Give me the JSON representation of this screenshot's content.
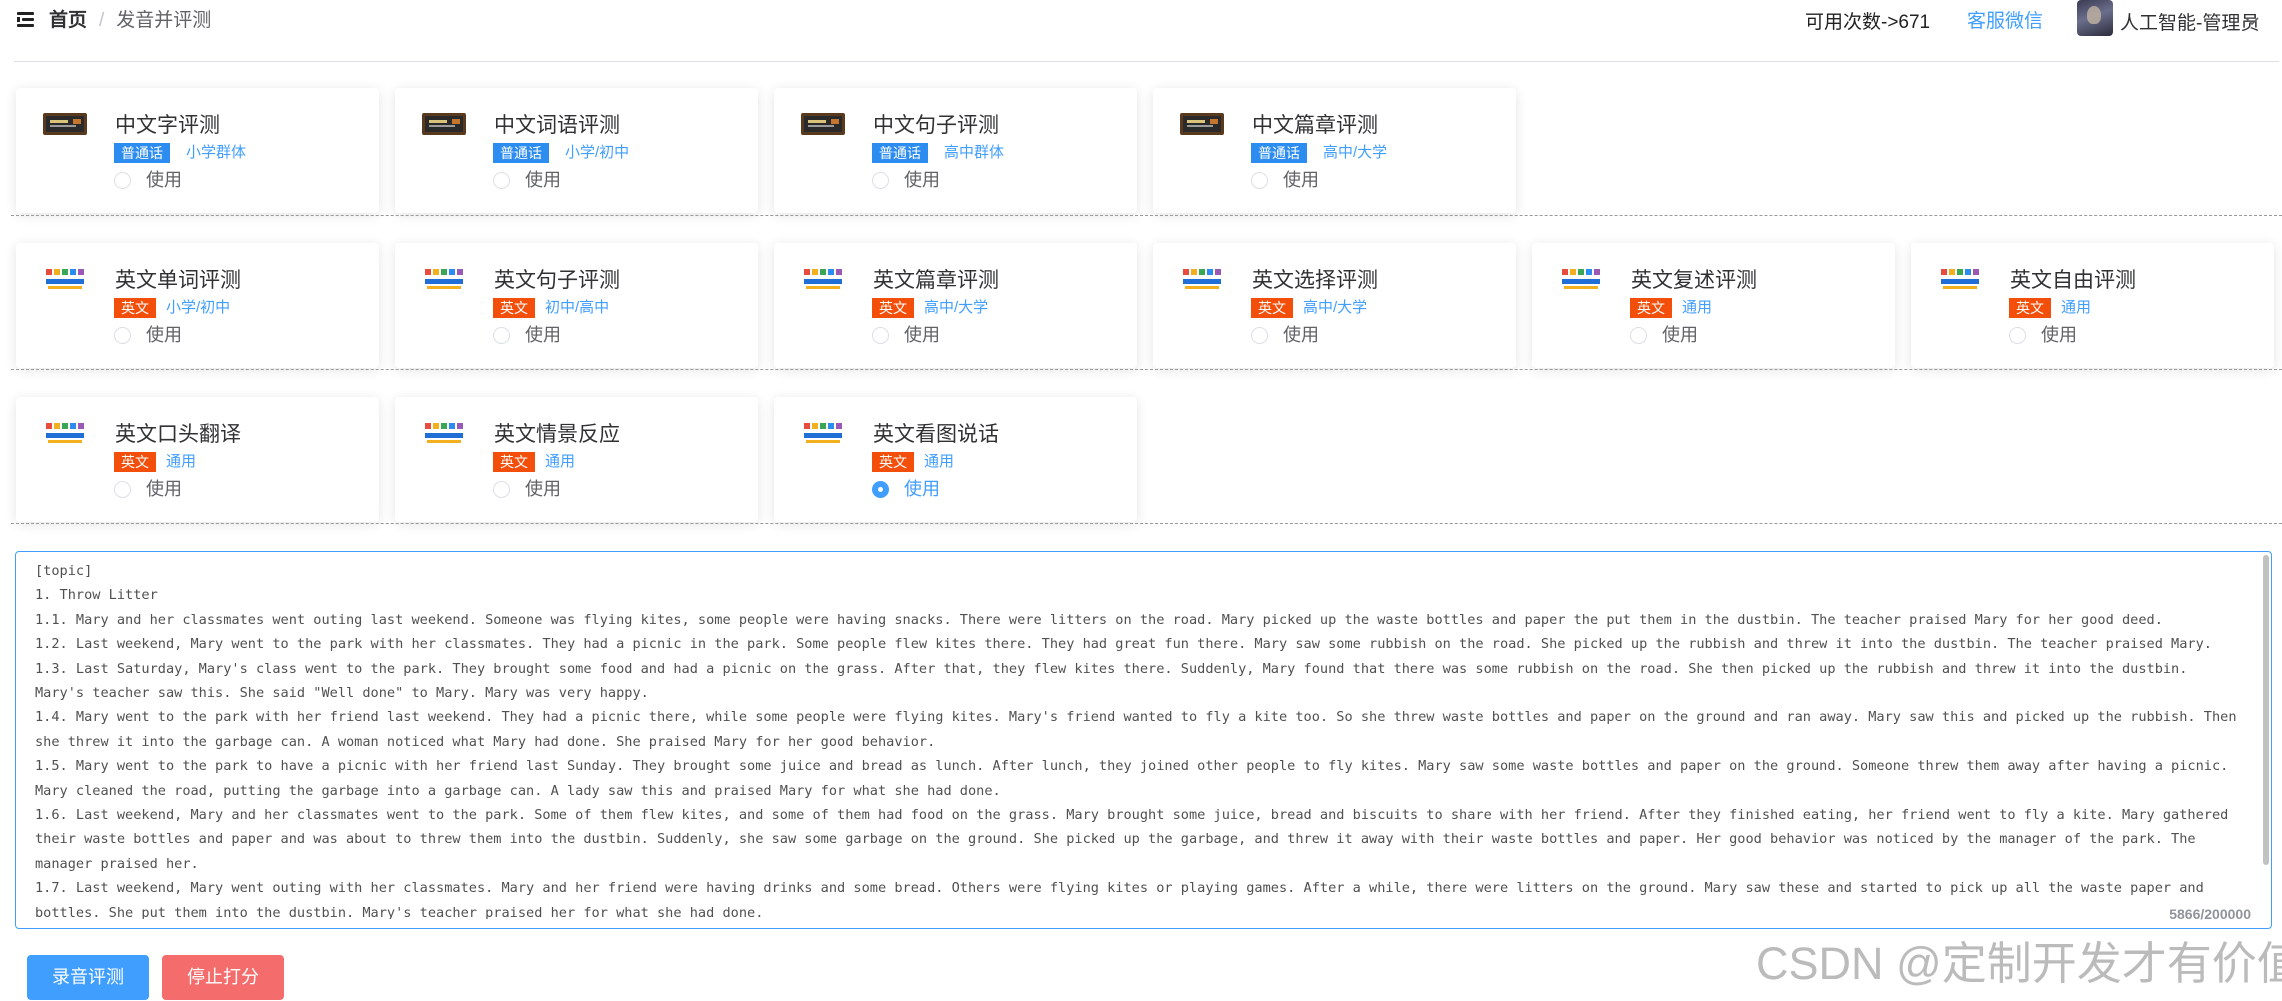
{
  "header": {
    "breadcrumb_home": "首页",
    "breadcrumb_sep": "/",
    "breadcrumb_current": "发音并评测",
    "usage_text": "可用次数->671",
    "service_link": "客服微信",
    "user_name": "人工智能-管理员"
  },
  "radio_label": "使用",
  "cards": [
    {
      "title": "中文字评测",
      "tag": "普通话",
      "level": "小学群体",
      "icon": "chalkboard-icon",
      "selected": false
    },
    {
      "title": "中文词语评测",
      "tag": "普通话",
      "level": "小学/初中",
      "icon": "chalkboard-icon",
      "selected": false
    },
    {
      "title": "中文句子评测",
      "tag": "普通话",
      "level": "高中群体",
      "icon": "chalkboard-icon",
      "selected": false
    },
    {
      "title": "中文篇章评测",
      "tag": "普通话",
      "level": "高中/大学",
      "icon": "chalkboard-icon",
      "selected": false
    },
    {
      "title": "英文单词评测",
      "tag": "英文",
      "level": "小学/初中",
      "icon": "learn-english-icon",
      "selected": false
    },
    {
      "title": "英文句子评测",
      "tag": "英文",
      "level": "初中/高中",
      "icon": "learn-english-icon",
      "selected": false
    },
    {
      "title": "英文篇章评测",
      "tag": "英文",
      "level": "高中/大学",
      "icon": "learn-english-icon",
      "selected": false
    },
    {
      "title": "英文选择评测",
      "tag": "英文",
      "level": "高中/大学",
      "icon": "learn-english-icon",
      "selected": false
    },
    {
      "title": "英文复述评测",
      "tag": "英文",
      "level": "通用",
      "icon": "learn-english-icon",
      "selected": false
    },
    {
      "title": "英文自由评测",
      "tag": "英文",
      "level": "通用",
      "icon": "learn-english-icon",
      "selected": false
    },
    {
      "title": "英文口头翻译",
      "tag": "英文",
      "level": "通用",
      "icon": "learn-english-icon",
      "selected": false
    },
    {
      "title": "英文情景反应",
      "tag": "英文",
      "level": "通用",
      "icon": "learn-english-icon",
      "selected": false
    },
    {
      "title": "英文看图说话",
      "tag": "英文",
      "level": "通用",
      "icon": "learn-english-icon",
      "selected": true
    }
  ],
  "topic": {
    "text": "[topic]\n1. Throw Litter\n1.1. Mary and her classmates went outing last weekend. Someone was flying kites, some people were having snacks. There were litters on the road. Mary picked up the waste bottles and paper the put them in the dustbin. The teacher praised Mary for her good deed.\n1.2. Last weekend, Mary went to the park with her classmates. They had a picnic in the park. Some people flew kites there. They had great fun there. Mary saw some rubbish on the road. She picked up the rubbish and threw it into the dustbin. The teacher praised Mary.\n1.3. Last Saturday, Mary's class went to the park. They brought some food and had a picnic on the grass. After that, they flew kites there. Suddenly, Mary found that there was some rubbish on the road. She then picked up the rubbish and threw it into the dustbin. Mary's teacher saw this. She said \"Well done\" to Mary. Mary was very happy.\n1.4. Mary went to the park with her friend last weekend. They had a picnic there, while some people were flying kites. Mary's friend wanted to fly a kite too. So she threw waste bottles and paper on the ground and ran away. Mary saw this and picked up the rubbish. Then she threw it into the garbage can. A woman noticed what Mary had done. She praised Mary for her good behavior.\n1.5. Mary went to the park to have a picnic with her friend last Sunday. They brought some juice and bread as lunch. After lunch, they joined other people to fly kites. Mary saw some waste bottles and paper on the ground. Someone threw them away after having a picnic. Mary cleaned the road, putting the garbage into a garbage can. A lady saw this and praised Mary for what she had done.\n1.6. Last weekend, Mary and her classmates went to the park. Some of them flew kites, and some of them had food on the grass. Mary brought some juice, bread and biscuits to share with her friend. After they finished eating, her friend went to fly a kite. Mary gathered their waste bottles and paper and was about to threw them into the dustbin. Suddenly, she saw some garbage on the ground. She picked up the garbage, and threw it away with their waste bottles and paper. Her good behavior was noticed by the manager of the park. The manager praised her.\n1.7. Last weekend, Mary went outing with her classmates. Mary and her friend were having drinks and some bread. Others were flying kites or playing games. After a while, there were litters on the ground. Mary saw these and started to pick up all the waste paper and bottles. She put them into the dustbin. Mary's teacher praised her for what she had done.",
    "char_count": "5866/200000"
  },
  "buttons": {
    "record": "录音评测",
    "stop": "停止打分"
  },
  "watermark": "CSDN @定制开发才有价值",
  "colors": {
    "primary": "#409eff",
    "danger": "#f56c6c",
    "tag_cn": "#2d8cf0",
    "tag_en": "#f34f0b"
  }
}
